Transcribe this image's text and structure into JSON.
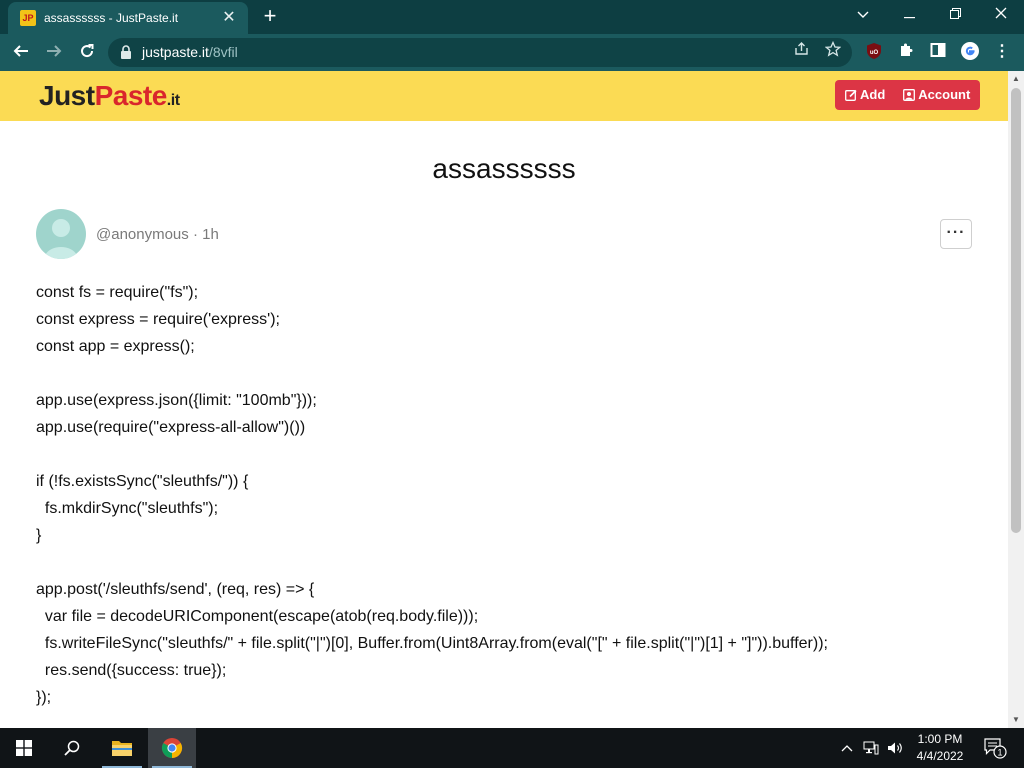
{
  "browser": {
    "tab_favicon_text": "JP",
    "tab_title": "assassssss - JustPaste.it",
    "url_host": "justpaste.it",
    "url_path": "/8vfil",
    "accent": "#1b5a5e",
    "titlebar_color": "#0d3e42"
  },
  "site": {
    "logo_just": "Just",
    "logo_paste": "Paste",
    "logo_it": ".it",
    "header_color": "#fbdb54",
    "add_label": "Add",
    "account_label": "Account",
    "button_color": "#dc3545"
  },
  "paste": {
    "title": "assassssss",
    "author": "@anonymous",
    "separator": "·",
    "age": "1h",
    "more_label": "···",
    "lines": [
      "const fs = require(\"fs\");",
      "const express = require('express');",
      "const app = express();",
      "",
      "app.use(express.json({limit: \"100mb\"}));",
      "app.use(require(\"express-all-allow\")())",
      "",
      "if (!fs.existsSync(\"sleuthfs/\")) {",
      "  fs.mkdirSync(\"sleuthfs\");",
      "}",
      "",
      "app.post('/sleuthfs/send', (req, res) => {",
      "  var file = decodeURIComponent(escape(atob(req.body.file)));",
      "  fs.writeFileSync(\"sleuthfs/\" + file.split(\"|\")[0], Buffer.from(Uint8Array.from(eval(\"[\" + file.split(\"|\")[1] + \"]\")).buffer));",
      "  res.send({success: true});",
      "});"
    ]
  },
  "taskbar": {
    "time": "1:00 PM",
    "date": "4/4/2022",
    "notification_count": "1"
  }
}
